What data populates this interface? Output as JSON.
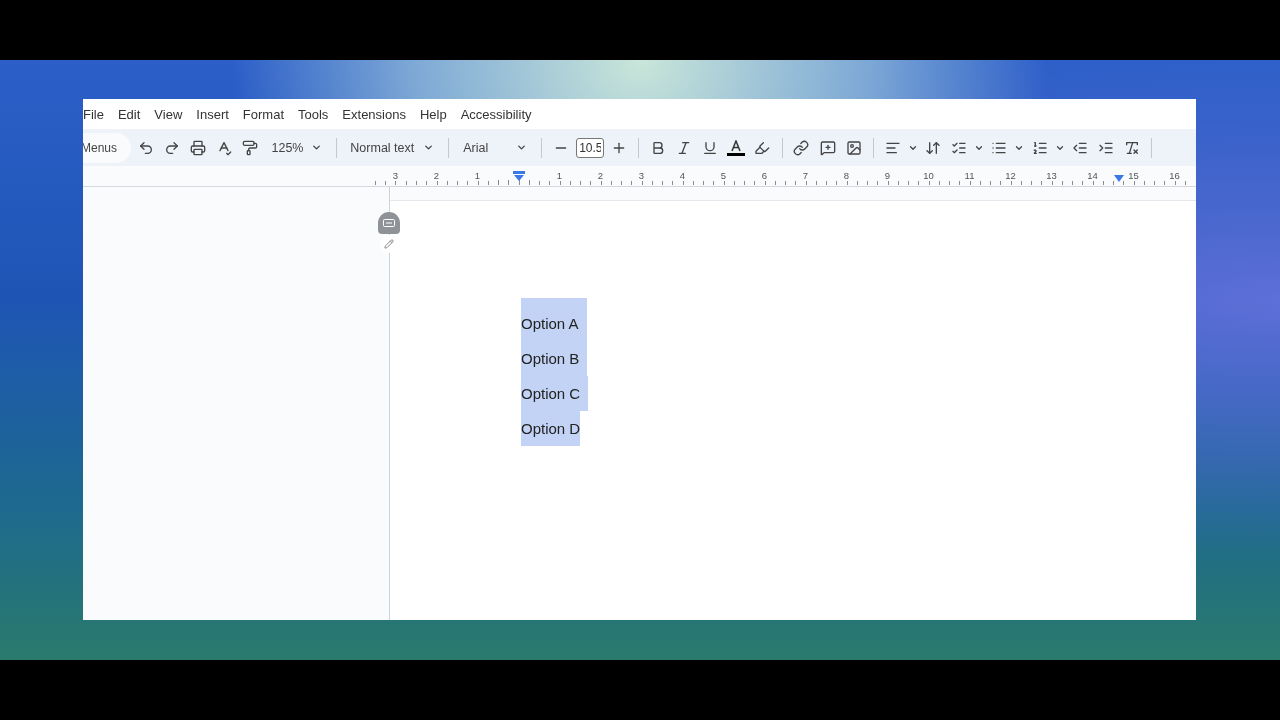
{
  "menu_bar": [
    "File",
    "Edit",
    "View",
    "Insert",
    "Format",
    "Tools",
    "Extensions",
    "Help",
    "Accessibility"
  ],
  "toolbar": {
    "menus_label": "Menus",
    "zoom": "125%",
    "style": "Normal text",
    "font": "Arial",
    "font_size": "10.5"
  },
  "ruler": [
    {
      "kind": "number",
      "label": "3"
    },
    {
      "kind": "number",
      "label": "2"
    },
    {
      "kind": "number",
      "label": "1"
    },
    {
      "kind": "indent"
    },
    {
      "kind": "number",
      "label": "1"
    },
    {
      "kind": "number",
      "label": "2"
    },
    {
      "kind": "number",
      "label": "3"
    },
    {
      "kind": "number",
      "label": "4"
    },
    {
      "kind": "number",
      "label": "5"
    },
    {
      "kind": "number",
      "label": "6"
    },
    {
      "kind": "number",
      "label": "7"
    },
    {
      "kind": "number",
      "label": "8"
    },
    {
      "kind": "number",
      "label": "9"
    },
    {
      "kind": "number",
      "label": "10"
    },
    {
      "kind": "number",
      "label": "11"
    },
    {
      "kind": "number",
      "label": "12"
    },
    {
      "kind": "number",
      "label": "13"
    },
    {
      "kind": "number",
      "label": "14"
    },
    {
      "kind": "number",
      "label": "15"
    },
    {
      "kind": "number",
      "label": "16"
    }
  ],
  "document": {
    "lines": [
      {
        "text": "Option A",
        "selected": true
      },
      {
        "text": "Option B",
        "selected": true
      },
      {
        "text": "Option C",
        "selected": true
      },
      {
        "text": "Option D",
        "selected": true
      }
    ]
  }
}
